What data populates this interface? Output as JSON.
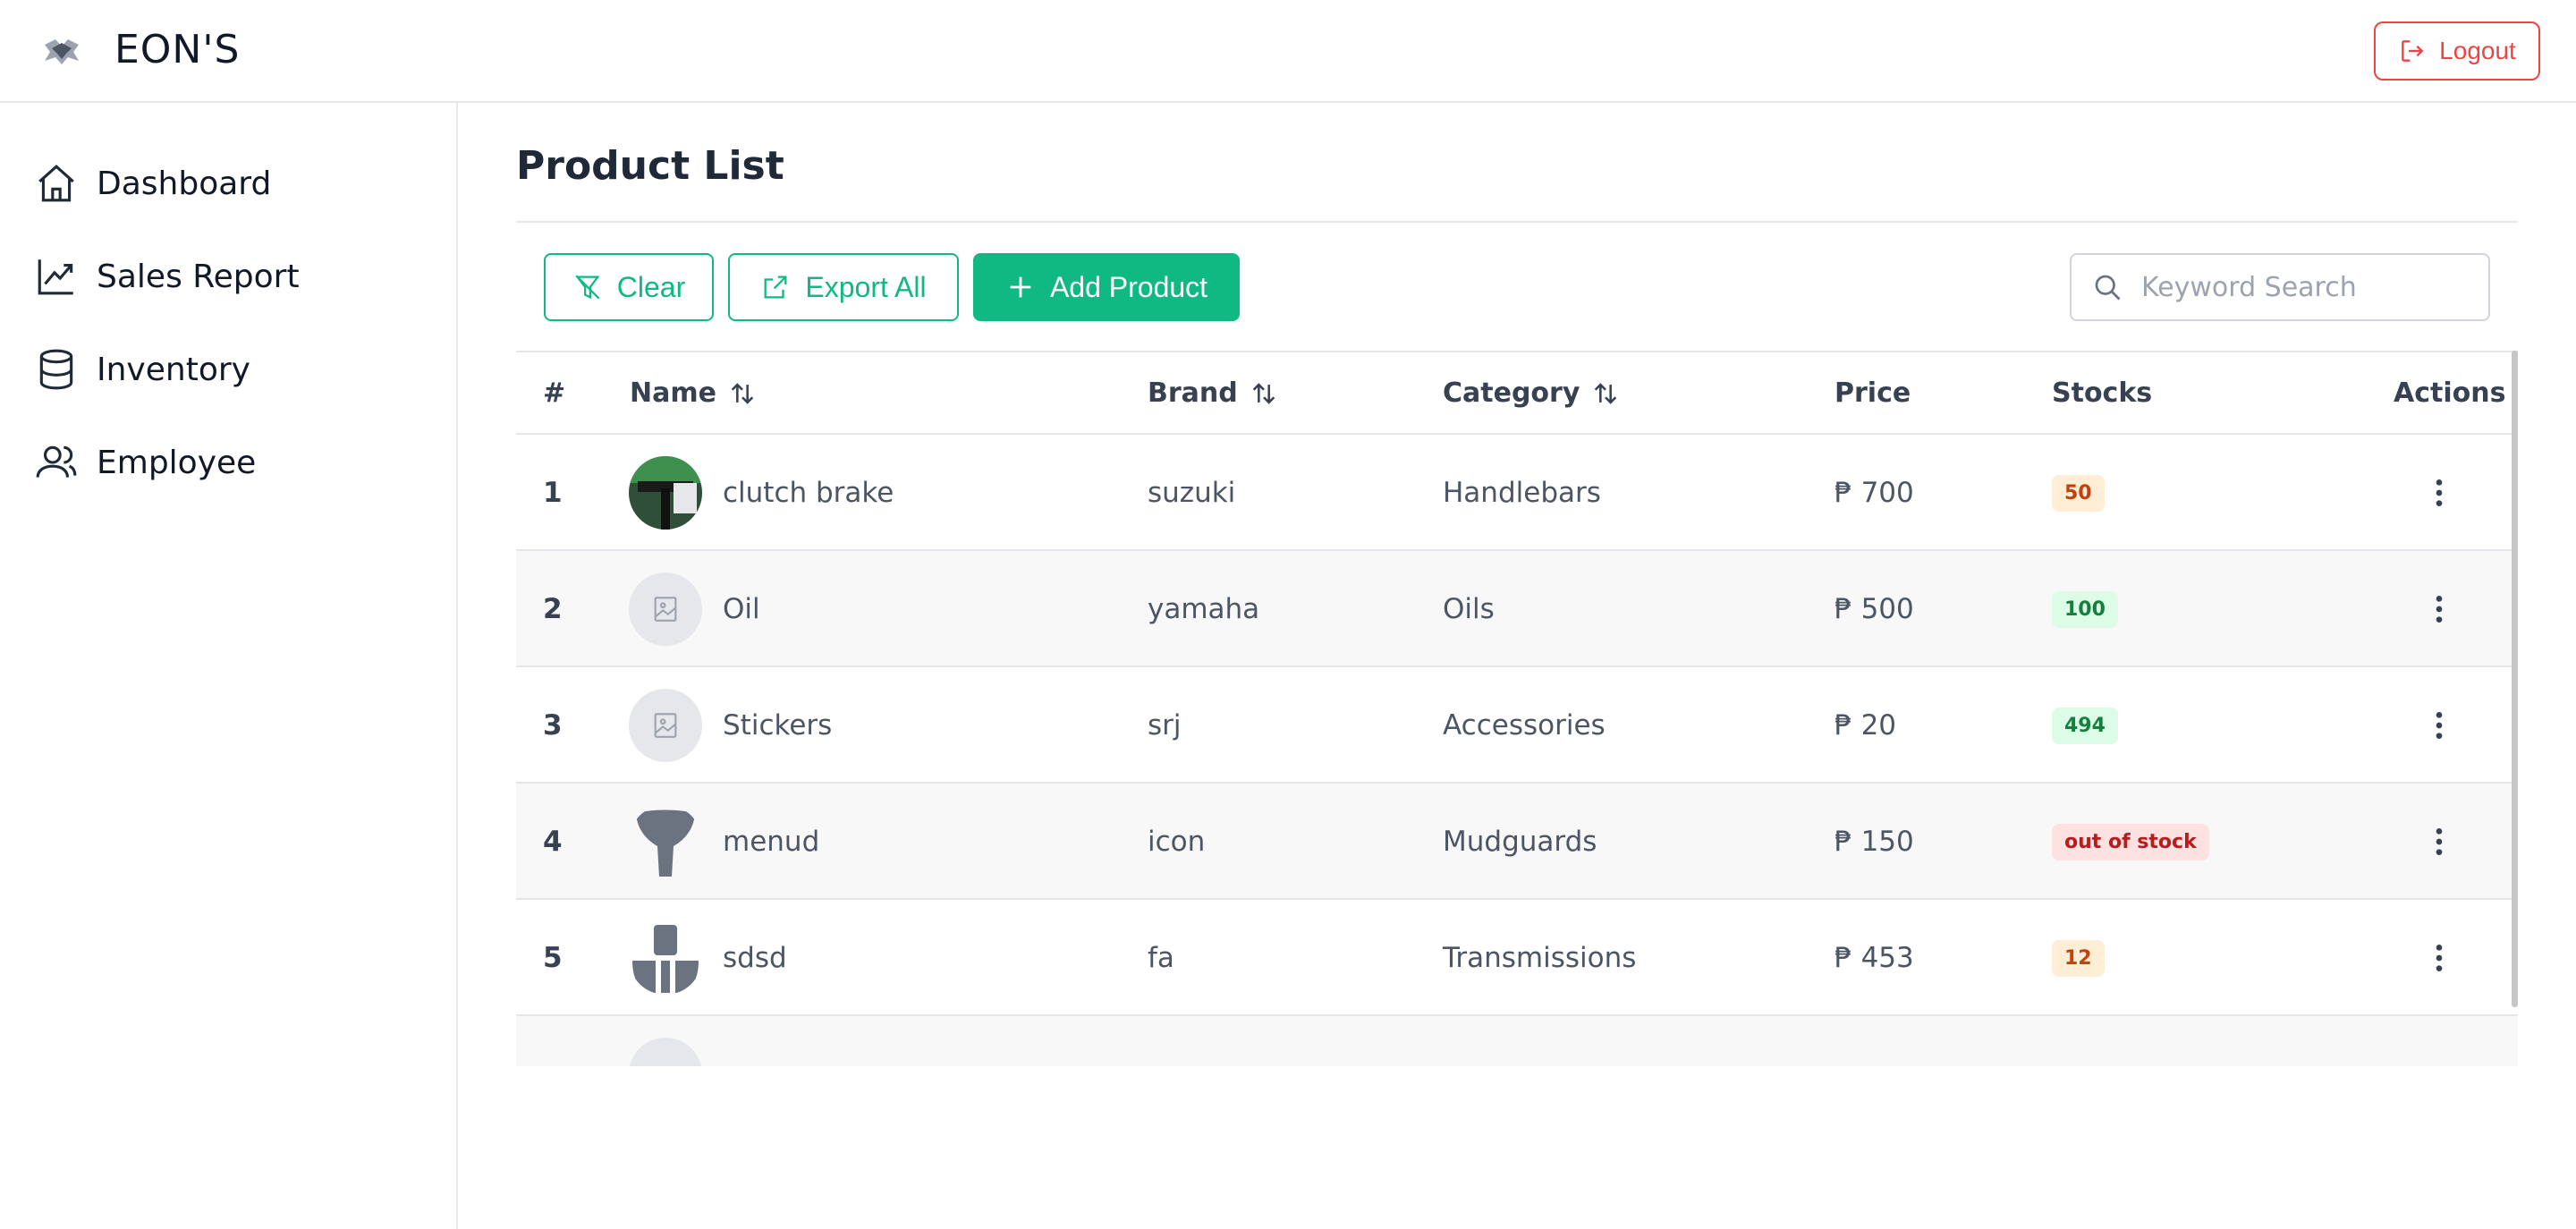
{
  "app": {
    "brand": "EON'S",
    "logout_label": "Logout"
  },
  "sidebar": {
    "items": [
      {
        "label": "Dashboard",
        "icon": "home-icon"
      },
      {
        "label": "Sales Report",
        "icon": "trending-up-icon"
      },
      {
        "label": "Inventory",
        "icon": "database-icon"
      },
      {
        "label": "Employee",
        "icon": "users-icon"
      }
    ]
  },
  "page": {
    "title": "Product List"
  },
  "toolbar": {
    "clear_label": "Clear",
    "export_label": "Export All",
    "add_label": "Add Product",
    "search_placeholder": "Keyword Search"
  },
  "table": {
    "headers": {
      "index": "#",
      "name": "Name",
      "brand": "Brand",
      "category": "Category",
      "price": "Price",
      "stocks": "Stocks",
      "actions": "Actions"
    },
    "rows": [
      {
        "index": "1",
        "name": "clutch brake",
        "brand": "suzuki",
        "category": "Handlebars",
        "price": "₱ 700",
        "stock": "50",
        "stock_status": "warn",
        "thumb": "photo"
      },
      {
        "index": "2",
        "name": "Oil",
        "brand": "yamaha",
        "category": "Oils",
        "price": "₱ 500",
        "stock": "100",
        "stock_status": "ok",
        "thumb": "placeholder"
      },
      {
        "index": "3",
        "name": "Stickers",
        "brand": "srj",
        "category": "Accessories",
        "price": "₱ 20",
        "stock": "494",
        "stock_status": "ok",
        "thumb": "placeholder"
      },
      {
        "index": "4",
        "name": "menud",
        "brand": "icon",
        "category": "Mudguards",
        "price": "₱ 150",
        "stock": "out of stock",
        "stock_status": "out",
        "thumb": "mudguard"
      },
      {
        "index": "5",
        "name": "sdsd",
        "brand": "fa",
        "category": "Transmissions",
        "price": "₱ 453",
        "stock": "12",
        "stock_status": "warn",
        "thumb": "transmission"
      }
    ]
  },
  "colors": {
    "accent": "#10b981",
    "danger": "#ef4444",
    "warn_bg": "#ffedd5",
    "ok_bg": "#dcfce7",
    "out_bg": "#fee2e2"
  }
}
